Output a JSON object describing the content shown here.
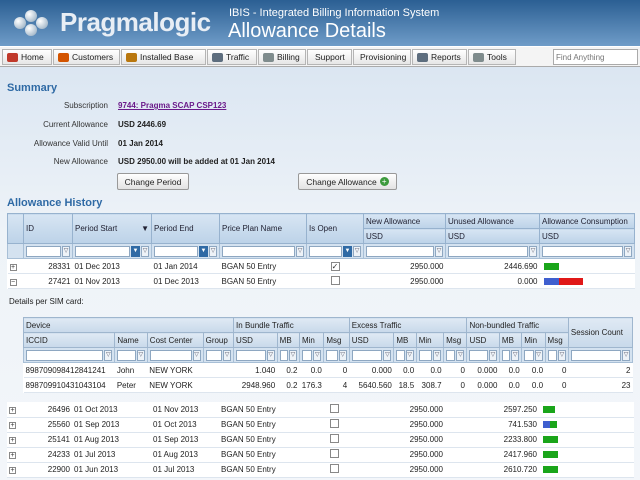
{
  "header": {
    "brand": "Pragmalogic",
    "subtitle": "IBIS - Integrated Billing Information System",
    "page_title": "Allowance Details"
  },
  "menu": [
    {
      "label": "Home",
      "icon": "home-icon",
      "color": "#c0392b"
    },
    {
      "label": "Customers",
      "icon": "customers-icon",
      "color": "#d35400"
    },
    {
      "label": "Installed Base",
      "icon": "installed-base-icon",
      "color": "#b9770e"
    },
    {
      "label": "Traffic",
      "icon": "traffic-icon",
      "color": "#5d6d7e"
    },
    {
      "label": "Billing",
      "icon": "billing-icon",
      "color": "#7f8c8d"
    },
    {
      "label": "Support",
      "icon": "",
      "color": ""
    },
    {
      "label": "Provisioning",
      "icon": "",
      "color": ""
    },
    {
      "label": "Reports",
      "icon": "reports-icon",
      "color": "#5d6d7e"
    },
    {
      "label": "Tools",
      "icon": "tools-icon",
      "color": "#7f8c8d"
    }
  ],
  "search": {
    "placeholder": "Find Anything"
  },
  "summary": {
    "title": "Summary",
    "subscription_label": "Subscription",
    "subscription_value": "9744: Pragma SCAP CSP123",
    "current_label": "Current Allowance",
    "current_value": "USD 2446.69",
    "valid_label": "Allowance Valid Until",
    "valid_value": "01 Jan 2014",
    "new_label": "New Allowance",
    "new_value": "USD 2950.00 will be added at 01 Jan 2014",
    "change_period": "Change Period",
    "change_allowance": "Change Allowance"
  },
  "history": {
    "title": "Allowance History",
    "headers": {
      "id": "ID",
      "start": "Period Start",
      "end": "Period End",
      "plan": "Price Plan Name",
      "open": "Is Open",
      "new": "New Allowance",
      "unused": "Unused Allowance",
      "consumption": "Allowance Consumption",
      "usd": "USD"
    },
    "rows": [
      {
        "exp": "+",
        "id": "28331",
        "start": "01 Dec 2013",
        "end": "01 Jan 2014",
        "plan": "BGAN 50 Entry",
        "open": true,
        "new": "2950.000",
        "unused": "2446.690",
        "bars": [
          {
            "pct": 0.17,
            "color": "#1aa51a"
          }
        ]
      },
      {
        "exp": "−",
        "id": "27421",
        "start": "01 Nov 2013",
        "end": "01 Dec 2013",
        "plan": "BGAN 50 Entry",
        "open": false,
        "new": "2950.000",
        "unused": "0.000",
        "bars": [
          {
            "pct": 0.17,
            "color": "#3f5fcf"
          },
          {
            "pct": 0.27,
            "color": "#e01818"
          }
        ]
      }
    ],
    "rows2": [
      {
        "id": "26496",
        "start": "01 Oct 2013",
        "end": "01 Nov 2013",
        "plan": "BGAN 50 Entry",
        "open": false,
        "new": "2950.000",
        "unused": "2597.250",
        "bars": [
          {
            "pct": 0.13,
            "color": "#1aa51a"
          }
        ]
      },
      {
        "id": "25560",
        "start": "01 Sep 2013",
        "end": "01 Oct 2013",
        "plan": "BGAN 50 Entry",
        "open": false,
        "new": "2950.000",
        "unused": "741.530",
        "bars": [
          {
            "pct": 0.08,
            "color": "#3f5fcf"
          },
          {
            "pct": 0.08,
            "color": "#1aa51a"
          }
        ]
      },
      {
        "id": "25141",
        "start": "01 Aug 2013",
        "end": "01 Sep 2013",
        "plan": "BGAN 50 Entry",
        "open": false,
        "new": "2950.000",
        "unused": "2233.800",
        "bars": [
          {
            "pct": 0.17,
            "color": "#1aa51a"
          }
        ]
      },
      {
        "id": "24233",
        "start": "01 Jul 2013",
        "end": "01 Aug 2013",
        "plan": "BGAN 50 Entry",
        "open": false,
        "new": "2950.000",
        "unused": "2417.960",
        "bars": [
          {
            "pct": 0.17,
            "color": "#1aa51a"
          }
        ]
      },
      {
        "id": "22900",
        "start": "01 Jun 2013",
        "end": "01 Jul 2013",
        "plan": "BGAN 50 Entry",
        "open": false,
        "new": "2950.000",
        "unused": "2610.720",
        "bars": [
          {
            "pct": 0.17,
            "color": "#1aa51a"
          }
        ]
      }
    ]
  },
  "sim": {
    "label": "Details per SIM card:",
    "groups": {
      "device": "Device",
      "bundle": "In Bundle Traffic",
      "excess": "Excess Traffic",
      "nonbundled": "Non-bundled Traffic",
      "sessions": "Session Count"
    },
    "cols": [
      "ICCID",
      "Name",
      "Cost Center",
      "Group",
      "USD",
      "MB",
      "Min",
      "Msg",
      "USD",
      "MB",
      "Min",
      "Msg",
      "USD",
      "MB",
      "Min",
      "Msg"
    ],
    "rows": [
      [
        "898709098412841241",
        "John",
        "NEW YORK",
        "",
        "1.040",
        "0.2",
        "0.0",
        "0",
        "0.000",
        "0.0",
        "0.0",
        "0",
        "0.000",
        "0.0",
        "0.0",
        "0",
        "2"
      ],
      [
        "898709910431043104",
        "Peter",
        "NEW YORK",
        "",
        "2948.960",
        "0.2",
        "176.3",
        "4",
        "5640.560",
        "18.5",
        "308.7",
        "0",
        "0.000",
        "0.0",
        "0.0",
        "0",
        "23"
      ]
    ]
  }
}
